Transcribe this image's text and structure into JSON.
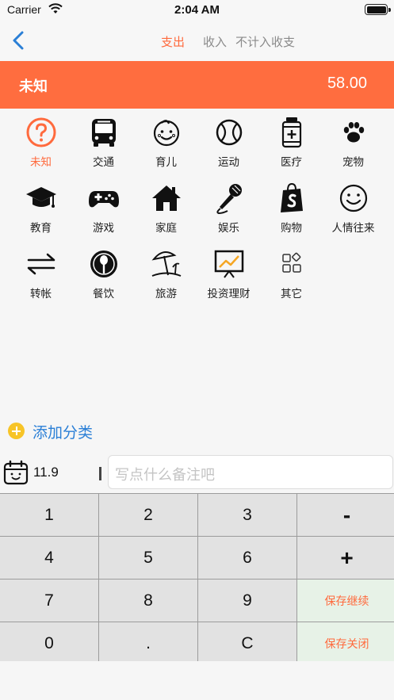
{
  "status": {
    "carrier": "Carrier",
    "time": "2:04 AM",
    "battery_level": 1.0
  },
  "nav": {
    "tabs": [
      {
        "label": "支出",
        "active": true
      },
      {
        "label": "收入",
        "active": false
      },
      {
        "label": "不计入收支",
        "active": false
      }
    ]
  },
  "selected": {
    "name": "未知",
    "amount": "58.00"
  },
  "categories": [
    {
      "label": "未知",
      "icon": "question-circle-icon"
    },
    {
      "label": "交通",
      "icon": "bus-icon"
    },
    {
      "label": "育儿",
      "icon": "baby-face-icon"
    },
    {
      "label": "运动",
      "icon": "ball-icon"
    },
    {
      "label": "医疗",
      "icon": "medicine-bottle-icon"
    },
    {
      "label": "宠物",
      "icon": "paw-icon"
    },
    {
      "label": "教育",
      "icon": "graduation-cap-icon"
    },
    {
      "label": "游戏",
      "icon": "gamepad-icon"
    },
    {
      "label": "家庭",
      "icon": "house-icon"
    },
    {
      "label": "娱乐",
      "icon": "microphone-icon"
    },
    {
      "label": "购物",
      "icon": "shopping-bag-icon"
    },
    {
      "label": "人情往来",
      "icon": "smile-icon"
    },
    {
      "label": "转帐",
      "icon": "transfer-arrows-icon"
    },
    {
      "label": "餐饮",
      "icon": "dining-icon"
    },
    {
      "label": "旅游",
      "icon": "beach-umbrella-icon"
    },
    {
      "label": "投资理财",
      "icon": "chart-board-icon"
    },
    {
      "label": "其它",
      "icon": "apps-icon"
    }
  ],
  "add_category": "添加分类",
  "date": "11.9",
  "note_placeholder": "写点什么备注吧",
  "keypad": {
    "rows": [
      [
        "1",
        "2",
        "3",
        "-"
      ],
      [
        "4",
        "5",
        "6",
        "+"
      ],
      [
        "7",
        "8",
        "9",
        "保存继续"
      ],
      [
        "0",
        ".",
        "C",
        "保存关闭"
      ]
    ]
  },
  "colors": {
    "accent": "#ff6d3f",
    "link": "#2a7fd6",
    "add_icon": "#f7c427",
    "save_bg": "#e7f2e7"
  }
}
